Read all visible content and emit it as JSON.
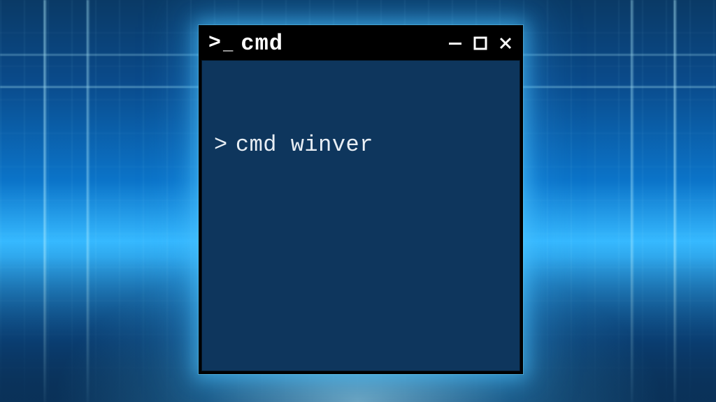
{
  "window": {
    "title": "cmd",
    "icon_glyph_gt": ">",
    "icon_glyph_underscore": "_"
  },
  "terminal": {
    "prompt": ">",
    "command": "cmd winver",
    "bg_color": "#0e365d",
    "fg_color": "#e8eef4"
  },
  "controls": {
    "minimize": "minimize",
    "maximize": "maximize",
    "close": "close"
  }
}
